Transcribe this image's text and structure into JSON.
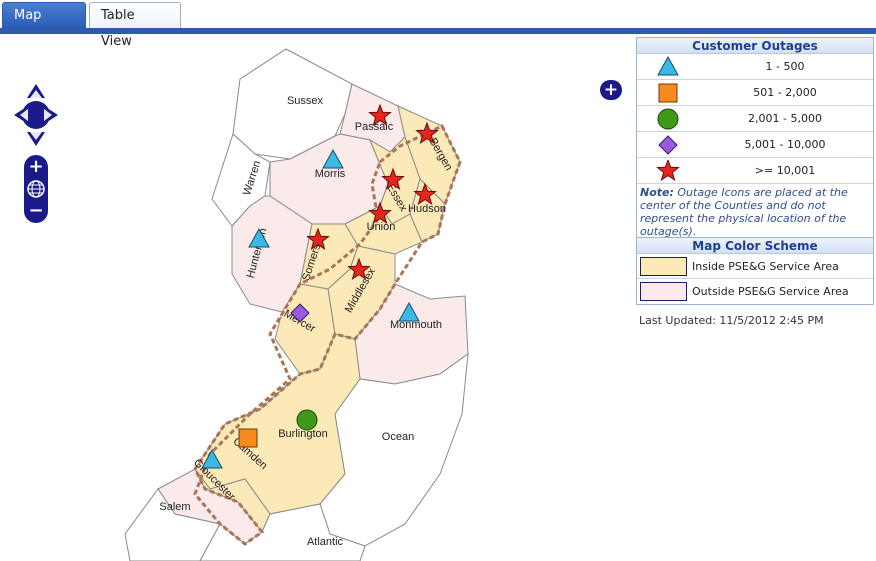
{
  "tabs": [
    {
      "label": "Map View",
      "active": true
    },
    {
      "label": "Table View",
      "active": false
    }
  ],
  "colors": {
    "accent": "#2f5aad",
    "inside_area": "#fbe9b8",
    "outside_area": "#fbeaea",
    "other_county": "#ffffff",
    "border_dashed": "#a9765a",
    "triangle": "#39b9e4",
    "square": "#f7891e",
    "circle": "#3f9a1a",
    "diamond": "#9b59e0",
    "star": "#e4261c"
  },
  "legend": {
    "title": "Customer Outages",
    "rows": [
      {
        "icon": "triangle-icon",
        "range": "1 - 500"
      },
      {
        "icon": "square-icon",
        "range": "501 - 2,000"
      },
      {
        "icon": "circle-icon",
        "range": "2,001 - 5,000"
      },
      {
        "icon": "diamond-icon",
        "range": "5,001 - 10,000"
      },
      {
        "icon": "star-icon",
        "range": ">= 10,001"
      }
    ],
    "note_label": "Note:",
    "note_text": "Outage Icons are placed at the center of the Counties and do not represent the physical location of the outage(s)."
  },
  "scheme": {
    "title": "Map Color Scheme",
    "rows": [
      {
        "label": "Inside PSE&G Service Area"
      },
      {
        "label": "Outside PSE&G Service Area"
      }
    ]
  },
  "updated": "Last Updated: 11/5/2012 2:45 PM",
  "counties": [
    {
      "name": "Sussex",
      "area": "other",
      "icon": null
    },
    {
      "name": "Passaic",
      "area": "outside",
      "icon": "star"
    },
    {
      "name": "Bergen",
      "area": "inside",
      "icon": "star"
    },
    {
      "name": "Morris",
      "area": "outside",
      "icon": "triangle"
    },
    {
      "name": "Warren",
      "area": "other",
      "icon": null
    },
    {
      "name": "Essex",
      "area": "inside",
      "icon": "star"
    },
    {
      "name": "Hudson",
      "area": "inside",
      "icon": "star"
    },
    {
      "name": "Union",
      "area": "inside",
      "icon": "star"
    },
    {
      "name": "Hunterdon",
      "area": "outside",
      "icon": "triangle"
    },
    {
      "name": "Somerset",
      "area": "inside",
      "icon": "star"
    },
    {
      "name": "Middlesex",
      "area": "inside",
      "icon": "star"
    },
    {
      "name": "Mercer",
      "area": "inside",
      "icon": "diamond"
    },
    {
      "name": "Monmouth",
      "area": "outside",
      "icon": "triangle"
    },
    {
      "name": "Burlington",
      "area": "inside",
      "icon": "circle"
    },
    {
      "name": "Ocean",
      "area": "other",
      "icon": null
    },
    {
      "name": "Camden",
      "area": "inside",
      "icon": "square"
    },
    {
      "name": "Gloucester",
      "area": "outside",
      "icon": "triangle"
    },
    {
      "name": "Salem",
      "area": "other",
      "icon": null
    },
    {
      "name": "Atlantic",
      "area": "other",
      "icon": null
    }
  ]
}
